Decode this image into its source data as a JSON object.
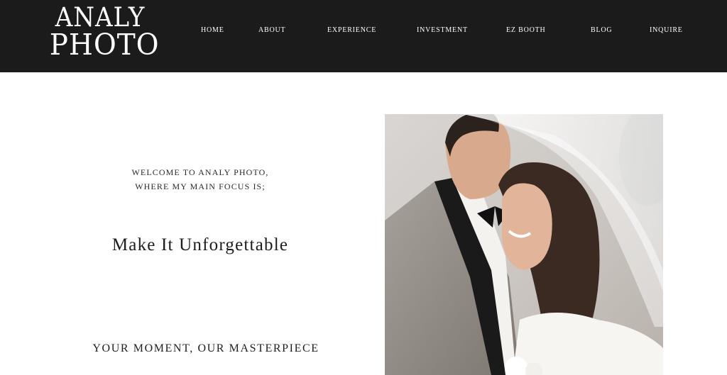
{
  "brand": {
    "line1": "ANALY",
    "line2": "PHOTO"
  },
  "nav": [
    {
      "label": "HOME"
    },
    {
      "label": "ABOUT"
    },
    {
      "label": "EXPERIENCE"
    },
    {
      "label": "INVESTMENT"
    },
    {
      "label": "EZ BOOTH"
    },
    {
      "label": "BLOG"
    },
    {
      "label": "INQUIRE"
    }
  ],
  "hero": {
    "welcome_line1": "WELCOME TO ANALY PHOTO,",
    "welcome_line2": "WHERE MY MAIN FOCUS IS;",
    "headline": "Make It Unforgettable",
    "tagline": "YOUR MOMENT, OUR MASTERPIECE"
  },
  "colors": {
    "header_bg": "#1c1b1b",
    "text_dark": "#1d1d1d",
    "nav_text": "#ffffff"
  }
}
